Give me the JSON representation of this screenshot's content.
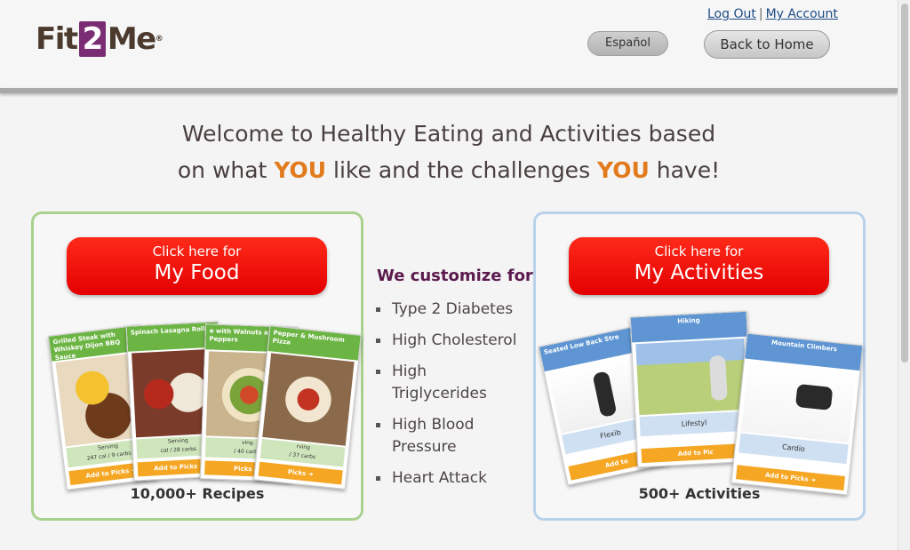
{
  "header": {
    "logo": {
      "pre": "Fit",
      "two": "2",
      "post": "Me",
      "mark": "®"
    },
    "log_out": "Log Out",
    "separator": "|",
    "my_account": "My Account",
    "espanol": "Español",
    "back_home": "Back to Home"
  },
  "welcome": {
    "line1": "Welcome to Healthy Eating and Activities based",
    "line2_a": "on what ",
    "you": "YOU",
    "line2_b": " like and the challenges ",
    "line2_c": " have!"
  },
  "food": {
    "btn_small": "Click here for",
    "btn_big": "My Food",
    "caption": "10,000+ Recipes",
    "cards": [
      {
        "title": "Grilled Steak with Whiskey Dijon BBQ Sauce",
        "serving": "Serving",
        "nutrition": "247 cal / 9 carbs",
        "add": "Add to Picks ➜"
      },
      {
        "title": "Spinach Lasagna Rolls",
        "serving": "Serving",
        "nutrition": "cal / 28 carbs",
        "add": "Add to Picks ➜"
      },
      {
        "title": "e with Walnuts and Peppers",
        "serving": "ving",
        "nutrition": "/ 40 carbs",
        "add": "Picks ➜"
      },
      {
        "title": "Pepper & Mushroom Pizza",
        "serving": "rving",
        "nutrition": "/ 37 carbs",
        "add": "Picks ➜"
      }
    ]
  },
  "middle": {
    "heading": "We customize for:",
    "conditions": [
      "Type 2 Diabetes",
      "High Cholesterol",
      "High Triglycerides",
      "High Blood Pressure",
      "Heart Attack"
    ]
  },
  "activities": {
    "btn_small": "Click here for",
    "btn_big": "My Activities",
    "caption": "500+ Activities",
    "cards": [
      {
        "title": "Seated Low Back Stre",
        "tag": "Flexib",
        "add": "Add to"
      },
      {
        "title": "Hiking",
        "tag": "Lifestyl",
        "add": "Add to Pic"
      },
      {
        "title": "Mountain Climbers",
        "tag": "Cardio",
        "add": "Add to Picks ➜"
      }
    ]
  },
  "colors": {
    "accent_orange": "#e27b1d",
    "button_red": "#e30000",
    "food_border": "#a9d18e",
    "activity_border": "#b8d2ea",
    "heading_purple": "#5a1a4e"
  }
}
